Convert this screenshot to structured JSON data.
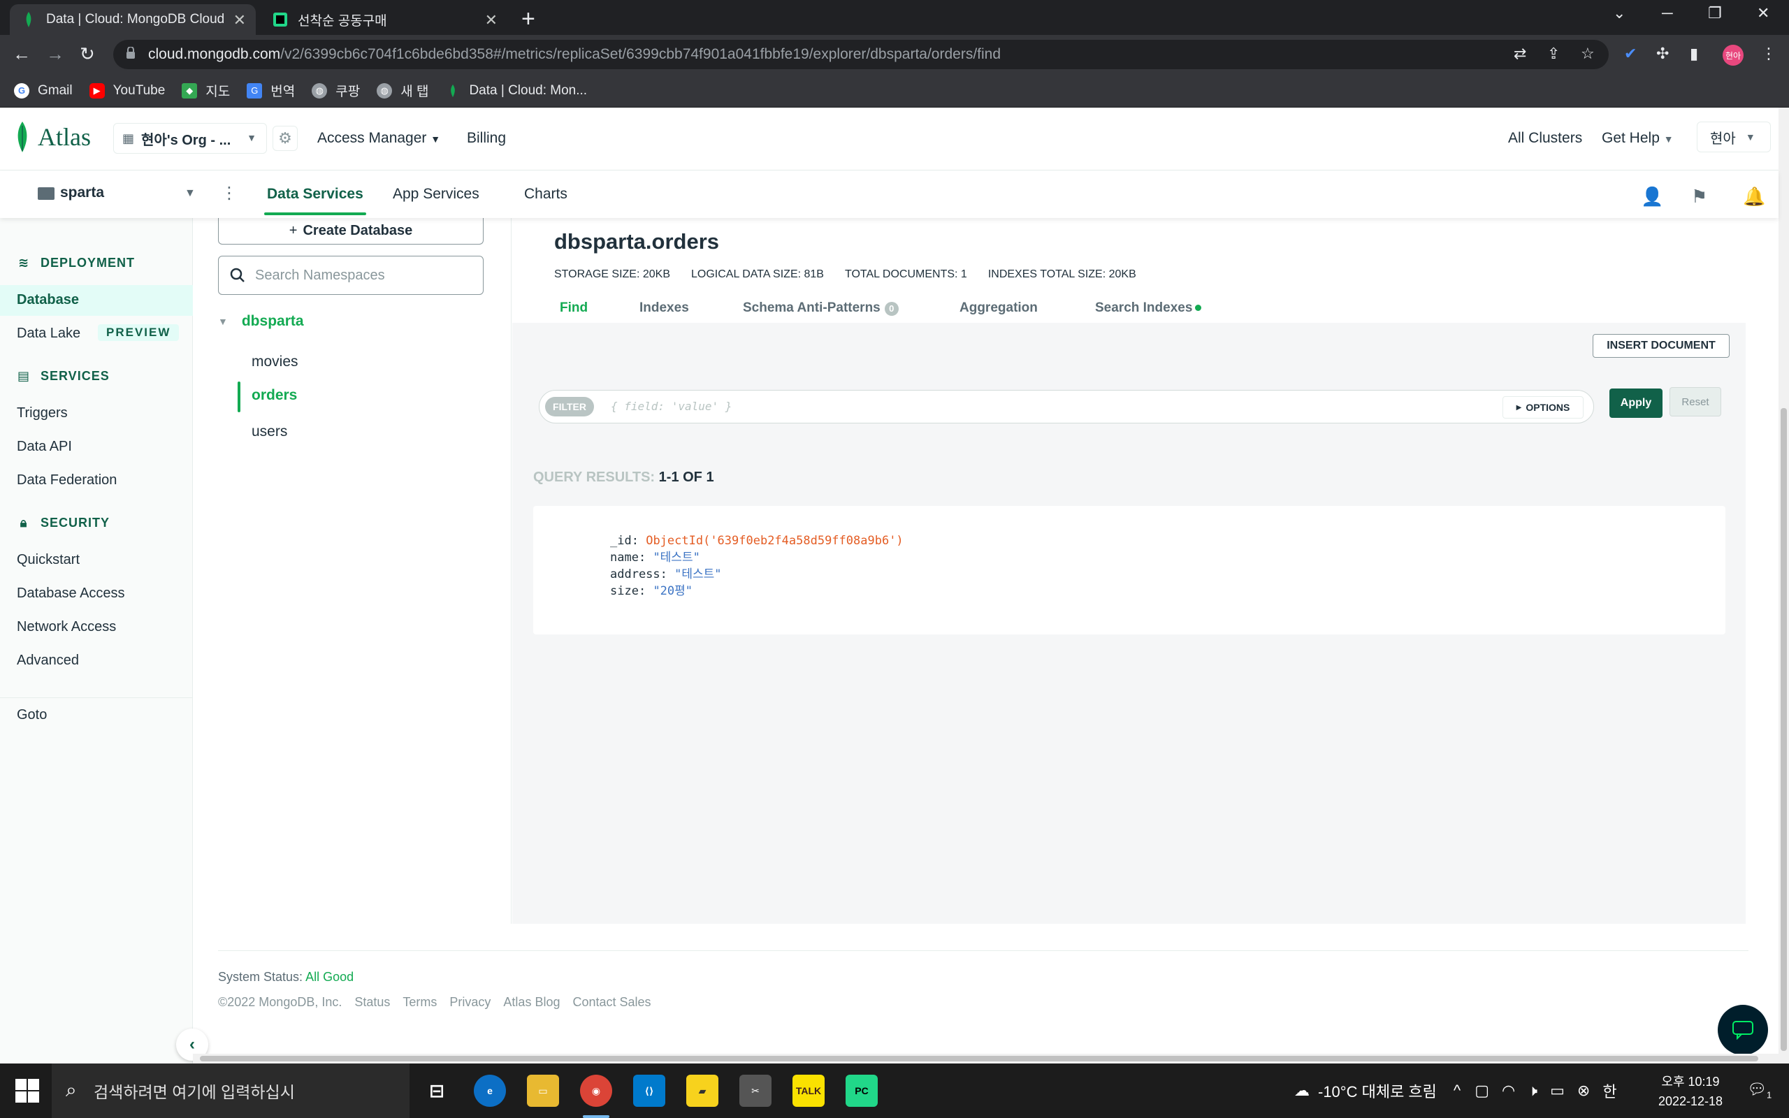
{
  "browser": {
    "tabs": [
      {
        "title": "Data | Cloud: MongoDB Cloud",
        "active": true
      },
      {
        "title": "선착순 공동구매",
        "active": false
      }
    ],
    "url_host": "cloud.mongodb.com",
    "url_path": "/v2/6399cb6c704f1c6bde6bd358#/metrics/replicaSet/6399cbb74f901a041fbbfe19/explorer/dbsparta/orders/find",
    "profile_label": "현아",
    "bookmarks": [
      "Gmail",
      "YouTube",
      "지도",
      "번역",
      "쿠팡",
      "새 탭",
      "Data | Cloud: Mon..."
    ]
  },
  "header": {
    "logo": "Atlas",
    "org": "현아's Org - ...",
    "links": [
      "Access Manager",
      "Billing"
    ],
    "right_links": [
      "All Clusters",
      "Get Help"
    ],
    "user": "현아"
  },
  "project_nav": {
    "project": "sparta",
    "tabs": [
      "Data Services",
      "App Services",
      "Charts"
    ],
    "active_tab": "Data Services"
  },
  "sidebar": {
    "deployment": {
      "heading": "DEPLOYMENT",
      "items": [
        "Database",
        "Data Lake"
      ],
      "preview_badge": "PREVIEW"
    },
    "services": {
      "heading": "SERVICES",
      "items": [
        "Triggers",
        "Data API",
        "Data Federation"
      ]
    },
    "security": {
      "heading": "SECURITY",
      "items": [
        "Quickstart",
        "Database Access",
        "Network Access",
        "Advanced"
      ]
    },
    "goto": "Goto"
  },
  "namespaces": {
    "create_label": "Create Database",
    "search_placeholder": "Search Namespaces",
    "database": "dbsparta",
    "collections": [
      "movies",
      "orders",
      "users"
    ],
    "active_collection": "orders"
  },
  "collection": {
    "title": "dbsparta.orders",
    "stats": [
      "STORAGE SIZE: 20KB",
      "LOGICAL DATA SIZE: 81B",
      "TOTAL DOCUMENTS: 1",
      "INDEXES TOTAL SIZE: 20KB"
    ],
    "tabs": [
      "Find",
      "Indexes",
      "Schema Anti-Patterns",
      "Aggregation",
      "Search Indexes"
    ],
    "schema_badge": "0",
    "insert_label": "INSERT DOCUMENT",
    "filter_label": "FILTER",
    "filter_placeholder": "{ field: 'value' }",
    "options_label": "OPTIONS",
    "apply_label": "Apply",
    "reset_label": "Reset",
    "results_prefix": "QUERY RESULTS: ",
    "results_count": "1-1 OF 1",
    "document": {
      "id_key": "_id:",
      "id_value": "ObjectId('639f0eb2f4a58d59ff08a9b6')",
      "name_key": "name:",
      "name_value": "\"테스트\"",
      "address_key": "address:",
      "address_value": "\"테스트\"",
      "size_key": "size:",
      "size_value": "\"20평\""
    }
  },
  "footer": {
    "status_prefix": "System Status: ",
    "status_value": "All Good",
    "links": [
      "©2022 MongoDB, Inc.",
      "Status",
      "Terms",
      "Privacy",
      "Atlas Blog",
      "Contact Sales"
    ]
  },
  "taskbar": {
    "search_placeholder": "검색하려면 여기에 입력하십시",
    "weather": "-10°C  대체로 흐림",
    "time": "오후 10:19",
    "date": "2022-12-18",
    "ime": "한",
    "notif_count": "1"
  },
  "colors": {
    "accent": "#13aa52",
    "brand_dark": "#116149",
    "oid": "#e45d24"
  }
}
